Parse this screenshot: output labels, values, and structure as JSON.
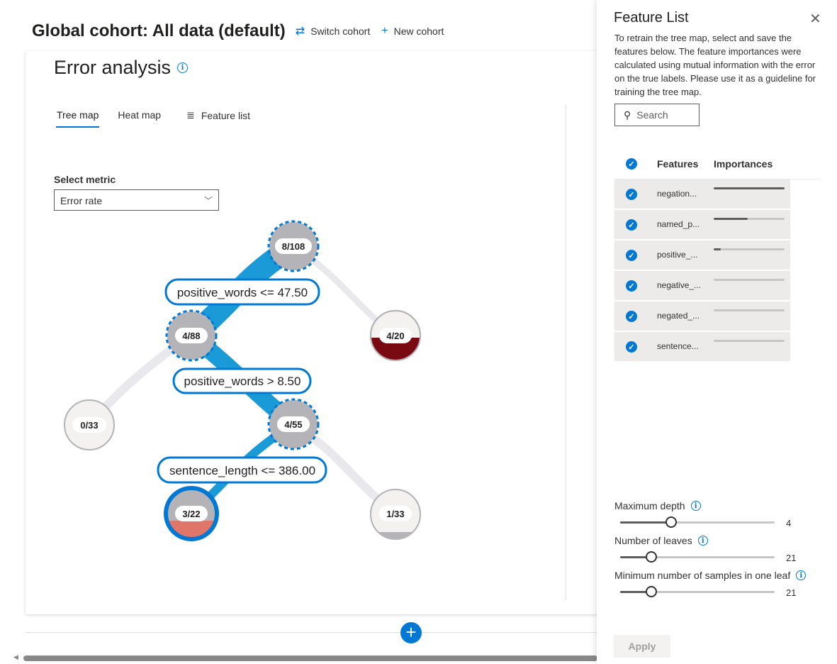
{
  "header": {
    "cohort_title": "Global cohort: All data (default)",
    "switch_cohort": "Switch cohort",
    "new_cohort": "New cohort"
  },
  "error_analysis": {
    "title": "Error analysis",
    "tabs": [
      "Tree map",
      "Heat map",
      "Feature list"
    ],
    "active_tab": "Tree map",
    "select_metric_label": "Select metric",
    "select_metric_value": "Error rate"
  },
  "tree": {
    "nodes": [
      {
        "label": "8/108",
        "errors": 8,
        "total": 108,
        "error_fraction": 0.07,
        "selected_path": true
      },
      {
        "label": "4/88",
        "errors": 4,
        "total": 88,
        "error_fraction": 0.05,
        "selected_path": true
      },
      {
        "label": "4/20",
        "errors": 4,
        "total": 20,
        "error_fraction": 0.45,
        "selected_path": false
      },
      {
        "label": "0/33",
        "errors": 0,
        "total": 33,
        "error_fraction": 0.0,
        "selected_path": false
      },
      {
        "label": "4/55",
        "errors": 4,
        "total": 55,
        "error_fraction": 0.07,
        "selected_path": true
      },
      {
        "label": "3/22",
        "errors": 3,
        "total": 22,
        "error_fraction": 0.36,
        "selected_path": true
      },
      {
        "label": "1/33",
        "errors": 1,
        "total": 33,
        "error_fraction": 0.1,
        "selected_path": false
      }
    ],
    "conditions": [
      "positive_words <= 47.50",
      "positive_words > 8.50",
      "sentence_length <= 386.00"
    ]
  },
  "panel": {
    "title": "Feature List",
    "description": "To retrain the tree map, select and save the features below. The feature importances were calculated using mutual information with the error on the true labels. Please use it as a guideline for training the tree map.",
    "search_placeholder": "Search",
    "col_features": "Features",
    "col_importances": "Importances",
    "features": [
      {
        "name": "negation...",
        "importance": 1.0,
        "checked": true
      },
      {
        "name": "named_p...",
        "importance": 0.48,
        "checked": true
      },
      {
        "name": "positive_...",
        "importance": 0.1,
        "checked": true
      },
      {
        "name": "negative_...",
        "importance": 0.0,
        "checked": true
      },
      {
        "name": "negated_...",
        "importance": 0.0,
        "checked": true
      },
      {
        "name": "sentence...",
        "importance": 0.0,
        "checked": true
      }
    ],
    "sliders": [
      {
        "label": "Maximum depth",
        "value": "4",
        "fraction": 0.33
      },
      {
        "label": "Number of leaves",
        "value": "21",
        "fraction": 0.2
      },
      {
        "label": "Minimum number of samples in one leaf",
        "value": "21",
        "fraction": 0.2
      }
    ],
    "apply_label": "Apply"
  },
  "colors": {
    "accent": "#0078d4",
    "path_link": "#1a9ad6",
    "node_gray": "#b3b3b8",
    "node_light": "#f3f2f1",
    "error_dark": "#7a0a12",
    "error_light": "#e0766a"
  }
}
